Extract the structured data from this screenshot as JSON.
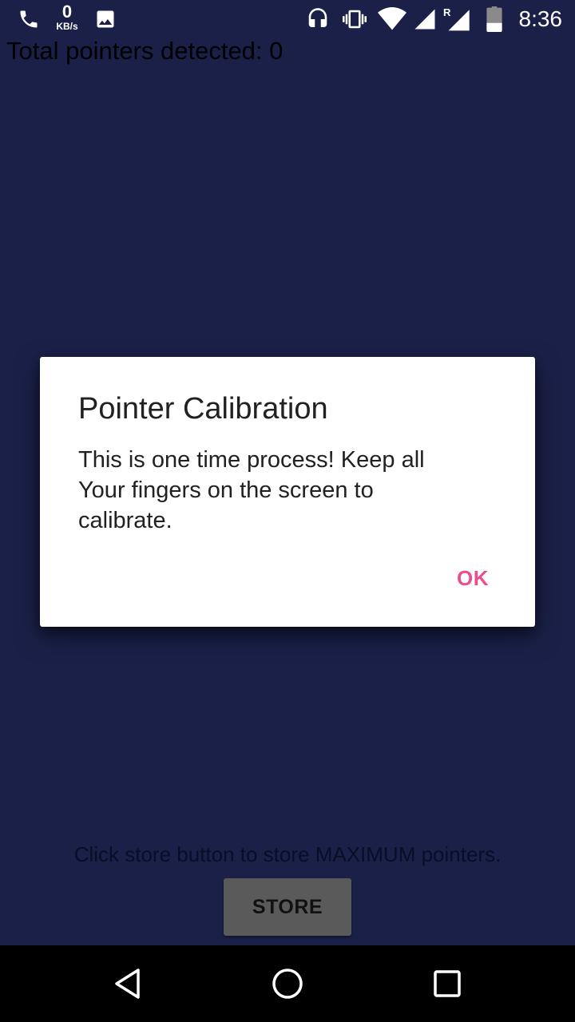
{
  "status_bar": {
    "net_speed_value": "0",
    "net_speed_unit": "KB/s",
    "time": "8:36",
    "roaming_marker": "R",
    "icons": [
      "phone-icon",
      "image-icon",
      "headset-icon",
      "vibrate-icon",
      "wifi-icon",
      "signal-icon",
      "signal-roaming-icon",
      "battery-icon"
    ]
  },
  "screen": {
    "pointer_count_text": "Total pointers detected: 0",
    "instruction_text": "Click store button to store MAXIMUM pointers.",
    "store_button_label": "STORE",
    "background_color": "#1b2049"
  },
  "dialog": {
    "title": "Pointer Calibration",
    "message": "This is one time process! Keep all Your fingers on the screen to calibrate.",
    "ok_label": "OK",
    "accent_color": "#e84f8f"
  },
  "nav_bar": {
    "buttons": [
      "back-icon",
      "home-icon",
      "recents-icon"
    ]
  }
}
